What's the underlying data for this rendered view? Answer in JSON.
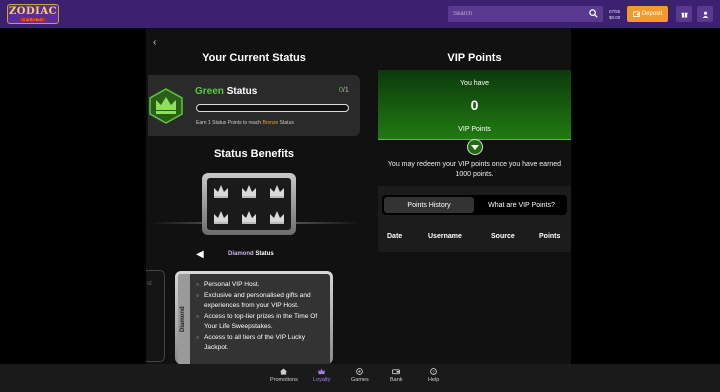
{
  "header": {
    "logo_top": "ZODIAC",
    "logo_bottom": "CASINO",
    "search_placeholder": "Search",
    "balance_id": "07/55",
    "balance_amount": "$0.00",
    "deposit_label": "Deposit"
  },
  "status": {
    "back_glyph": "‹",
    "heading": "Your Current Status",
    "level_color_word": "Green",
    "level_suffix": "Status",
    "progress_current": "0",
    "progress_total": "/1",
    "progress_fraction": 0,
    "earn_prefix": "Earn 1 Status Points to reach",
    "earn_target": "Bronze",
    "earn_suffix": "Status"
  },
  "benefits": {
    "heading": "Status Benefits",
    "selected_tier": "Diamond",
    "selected_suffix": "Status",
    "prev_arrow": "◀",
    "ghost_text": "st",
    "card_tier": "Diamond",
    "items": [
      "Personal VIP Host.",
      "Exclusive and personalised gifts and experiences from your VIP Host.",
      "Access to top-tier prizes in the Time Of Your Life Sweepstakes.",
      "Access to all tiers of the VIP Lucky Jackpot."
    ]
  },
  "vip": {
    "heading": "VIP Points",
    "you_have": "You have",
    "points": "0",
    "points_label": "VIP Points",
    "redeem_text": "You may redeem your VIP points once you have earned 1000 points.",
    "tabs": [
      "Points History",
      "What are VIP Points?"
    ],
    "columns": [
      "Date",
      "Username",
      "Source",
      "Points"
    ]
  },
  "nav": [
    {
      "label": "Promotions",
      "icon": "home-icon"
    },
    {
      "label": "Loyalty",
      "icon": "crown-icon"
    },
    {
      "label": "Games",
      "icon": "games-icon"
    },
    {
      "label": "Bank",
      "icon": "bank-icon"
    },
    {
      "label": "Help",
      "icon": "help-icon"
    }
  ],
  "colors": {
    "topbar": "#3b2170",
    "accent_green": "#5ac83c",
    "deposit": "#f29b2a",
    "active_nav": "#a97fe6"
  }
}
